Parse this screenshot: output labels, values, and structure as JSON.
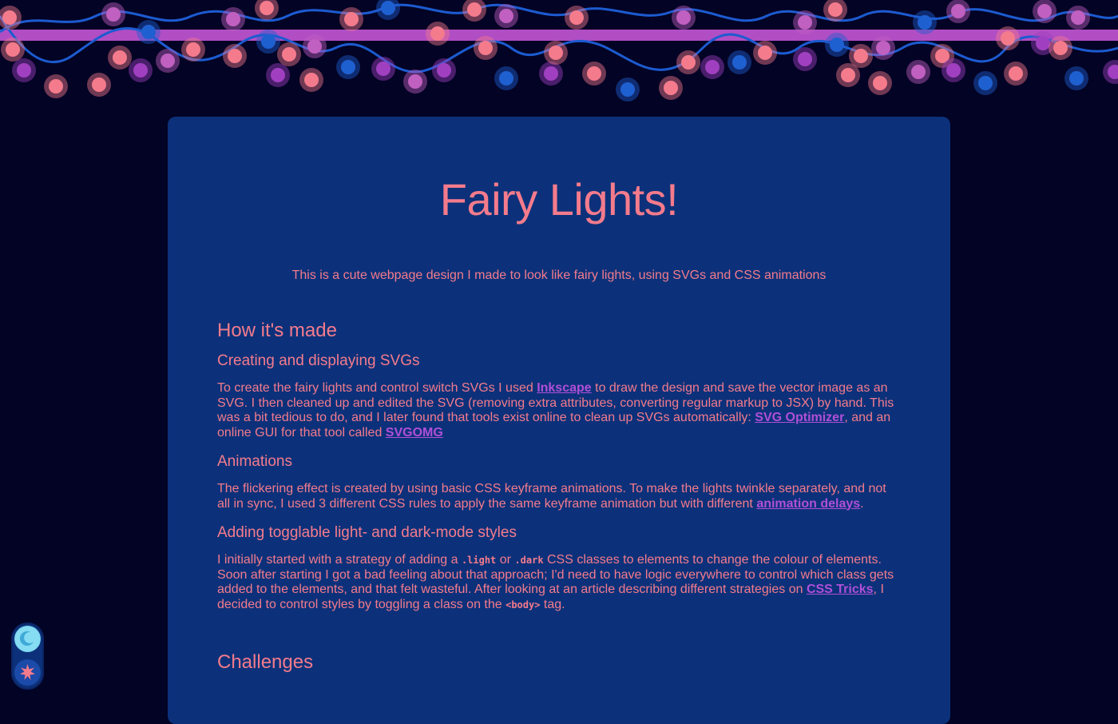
{
  "title": "Fairy Lights!",
  "subtitle": "This is a cute webpage design I made to look like fairy lights, using SVGs and CSS animations",
  "how": {
    "heading": "How it's made",
    "svg": {
      "heading": "Creating and displaying SVGs",
      "t1": "To create the fairy lights and control switch SVGs I used ",
      "l1": "Inkscape",
      "t2": " to draw the design and save the vector image as an SVG. I then cleaned up and edited the SVG (removing extra attributes, converting regular markup to JSX) by hand. This was a bit tedious to do, and I later found that tools exist online to clean up SVGs automatically: ",
      "l2": "SVG Optimizer",
      "t3": ", and an online GUI for that tool called ",
      "l3": "SVGOMG"
    },
    "anim": {
      "heading": "Animations",
      "t1": "The flickering effect is created by using basic CSS keyframe animations. To make the lights twinkle separately, and not all in sync, I used 3 different CSS rules to apply the same keyframe animation but with different ",
      "l1": "animation delays",
      "t2": "."
    },
    "modes": {
      "heading": "Adding togglable light- and dark-mode styles",
      "t1": "I initially started with a strategy of adding a ",
      "c1": ".light",
      "t2": " or ",
      "c2": ".dark",
      "t3": " CSS classes to elements to change the colour of elements. Soon after starting I got a bad feeling about that approach; I'd need to have logic everywhere to control which class gets added to the elements, and that felt wasteful. After looking at an article describing different strategies on ",
      "l1": "CSS Tricks",
      "t4": ", I decided to control styles by toggling a class on the ",
      "c3": "<body>",
      "t5": " tag."
    }
  },
  "challenges": {
    "heading": "Challenges"
  },
  "toggle": {
    "moon_icon": "moon-icon",
    "sun_icon": "sun-icon",
    "active_mode": "dark"
  },
  "colors": {
    "page_bg": "#030325",
    "card_bg": "#0c317a",
    "text": "#f47b8c",
    "link": "#b04fd8",
    "wire": "#1c5bd0",
    "rail": "#b14ec4"
  },
  "lights_decoration": {
    "bulb_colors": [
      "#f47b8c",
      "#a040c0",
      "#c060c0",
      "#1f60d0"
    ]
  }
}
